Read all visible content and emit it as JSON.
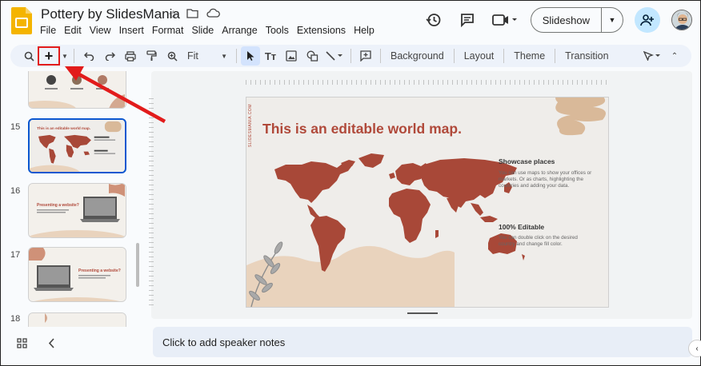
{
  "header": {
    "doc_title": "Pottery by SlidesMania",
    "menu": [
      "File",
      "Edit",
      "View",
      "Insert",
      "Format",
      "Slide",
      "Arrange",
      "Tools",
      "Extensions",
      "Help"
    ],
    "slideshow_label": "Slideshow"
  },
  "toolbar": {
    "zoom_value": "Fit",
    "background_label": "Background",
    "layout_label": "Layout",
    "theme_label": "Theme",
    "transition_label": "Transition"
  },
  "slides": [
    {
      "number": "15",
      "title": "This is an editable world map."
    },
    {
      "number": "16",
      "title": "Presenting a website?"
    },
    {
      "number": "17",
      "title": "Presenting a website?"
    },
    {
      "number": "18"
    }
  ],
  "slide": {
    "vertical_text": "SLIDESMANIA.COM",
    "title": "This is an editable world map.",
    "info1_head": "Showcase places",
    "info1_body": "You can use maps to show your offices or markets. Or as charts, highlighting the countries and adding your data.",
    "info2_head": "100% Editable",
    "info2_body": "You can double click on the desired country and change fill color."
  },
  "notes": {
    "placeholder": "Click to add speaker notes"
  },
  "colors": {
    "accent_red": "#b0493a",
    "highlight": "#e21b1b",
    "selected_border": "#0b57d0",
    "map": "#a84838",
    "blob": "#d9b999"
  }
}
